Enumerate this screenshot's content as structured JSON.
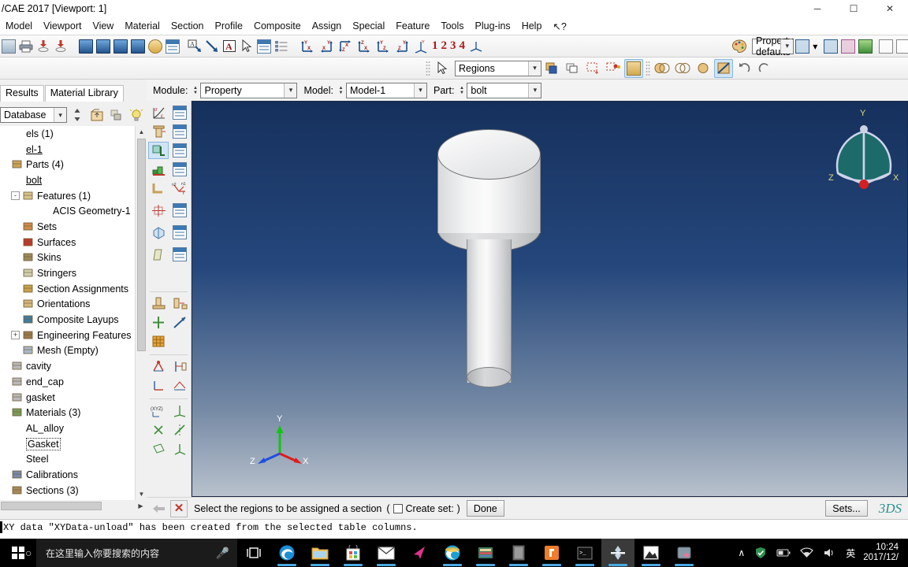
{
  "window": {
    "title": "/CAE 2017 [Viewport: 1]",
    "minimize": "─",
    "maximize": "☐",
    "close": "✕"
  },
  "menubar": {
    "items": [
      {
        "label": "Model"
      },
      {
        "label": "Viewport"
      },
      {
        "label": "View"
      },
      {
        "label": "Material"
      },
      {
        "label": "Section"
      },
      {
        "label": "Profile"
      },
      {
        "label": "Composite"
      },
      {
        "label": "Assign"
      },
      {
        "label": "Special"
      },
      {
        "label": "Feature"
      },
      {
        "label": "Tools"
      },
      {
        "label": "Plug-ins"
      },
      {
        "label": "Help"
      },
      {
        "label": "↖?"
      }
    ]
  },
  "toolbar_main": {
    "view_numbers": [
      "1",
      "2",
      "3",
      "4"
    ],
    "render_style_combo": "Property defaults",
    "render_style_arrow": "▾"
  },
  "toolbar_second": {
    "selection_combo": "Regions",
    "selection_arrow": "▾"
  },
  "context_bar": {
    "module_label": "Module:",
    "module_value": "Property",
    "model_label": "Model:",
    "model_value": "Model-1",
    "part_label": "Part:",
    "part_value": "bolt"
  },
  "left_panel": {
    "tabs": [
      {
        "label": "Results"
      },
      {
        "label": "Material Library"
      }
    ],
    "tree_filter": "Database",
    "tree": [
      {
        "label": "els (1)",
        "indent": 0,
        "expander": "",
        "icon": "none",
        "underline": false
      },
      {
        "label": "el-1",
        "indent": 0,
        "expander": "",
        "icon": "none",
        "underline": true
      },
      {
        "label": "Parts (4)",
        "indent": 0,
        "expander": "",
        "icon": "parts",
        "underline": false
      },
      {
        "label": "bolt",
        "indent": 0,
        "expander": "",
        "icon": "none",
        "underline": true
      },
      {
        "label": "Features (1)",
        "indent": 14,
        "expander": "-",
        "icon": "feature",
        "underline": false
      },
      {
        "label": "ACIS Geometry-1",
        "indent": 34,
        "expander": "",
        "icon": "none",
        "underline": false
      },
      {
        "label": "Sets",
        "indent": 14,
        "expander": "",
        "icon": "sets",
        "underline": false
      },
      {
        "label": "Surfaces",
        "indent": 14,
        "expander": "",
        "icon": "surfaces",
        "underline": false
      },
      {
        "label": "Skins",
        "indent": 14,
        "expander": "",
        "icon": "skins",
        "underline": false
      },
      {
        "label": "Stringers",
        "indent": 14,
        "expander": "",
        "icon": "stringers",
        "underline": false
      },
      {
        "label": "Section Assignments",
        "indent": 14,
        "expander": "",
        "icon": "sectasn",
        "underline": false
      },
      {
        "label": "Orientations",
        "indent": 14,
        "expander": "",
        "icon": "orient",
        "underline": false
      },
      {
        "label": "Composite Layups",
        "indent": 14,
        "expander": "",
        "icon": "layups",
        "underline": false
      },
      {
        "label": "Engineering Features",
        "indent": 14,
        "expander": "+",
        "icon": "engfeat",
        "underline": false
      },
      {
        "label": "Mesh (Empty)",
        "indent": 14,
        "expander": "",
        "icon": "mesh",
        "underline": false
      },
      {
        "label": "cavity",
        "indent": 0,
        "expander": "",
        "icon": "part",
        "underline": false
      },
      {
        "label": "end_cap",
        "indent": 0,
        "expander": "",
        "icon": "part",
        "underline": false
      },
      {
        "label": "gasket",
        "indent": 0,
        "expander": "",
        "icon": "part",
        "underline": false
      },
      {
        "label": "Materials (3)",
        "indent": 0,
        "expander": "",
        "icon": "materials",
        "underline": false
      },
      {
        "label": "AL_alloy",
        "indent": 0,
        "expander": "",
        "icon": "none",
        "underline": false
      },
      {
        "label": "Gasket",
        "indent": 0,
        "expander": "",
        "icon": "none",
        "underline": false,
        "focused": true
      },
      {
        "label": "Steel",
        "indent": 0,
        "expander": "",
        "icon": "none",
        "underline": false
      },
      {
        "label": "Calibrations",
        "indent": 0,
        "expander": "",
        "icon": "calib",
        "underline": false
      },
      {
        "label": "Sections (3)",
        "indent": 0,
        "expander": "",
        "icon": "sections",
        "underline": false
      }
    ]
  },
  "viewport": {
    "triad": {
      "x": "X",
      "y": "Y",
      "z": "Z"
    },
    "view_cube": {
      "x": "X",
      "y": "Y",
      "z": "Z"
    }
  },
  "prompt_bar": {
    "back_arrow": "←",
    "cancel": "✕",
    "message": "Select the regions to be assigned a section",
    "paren_open": "(",
    "create_set_label": "Create set:",
    "paren_close": ")",
    "done_label": "Done",
    "sets_label": "Sets...",
    "logo": "3DS"
  },
  "message_area": {
    "text": "XY data \"XYData-unload\" has been created from the selected table columns."
  },
  "taskbar": {
    "search_placeholder": "在这里输入你要搜索的内容",
    "ime": "英",
    "time": "10:24",
    "date": "2017/12/",
    "tray_chevron": "∧"
  }
}
